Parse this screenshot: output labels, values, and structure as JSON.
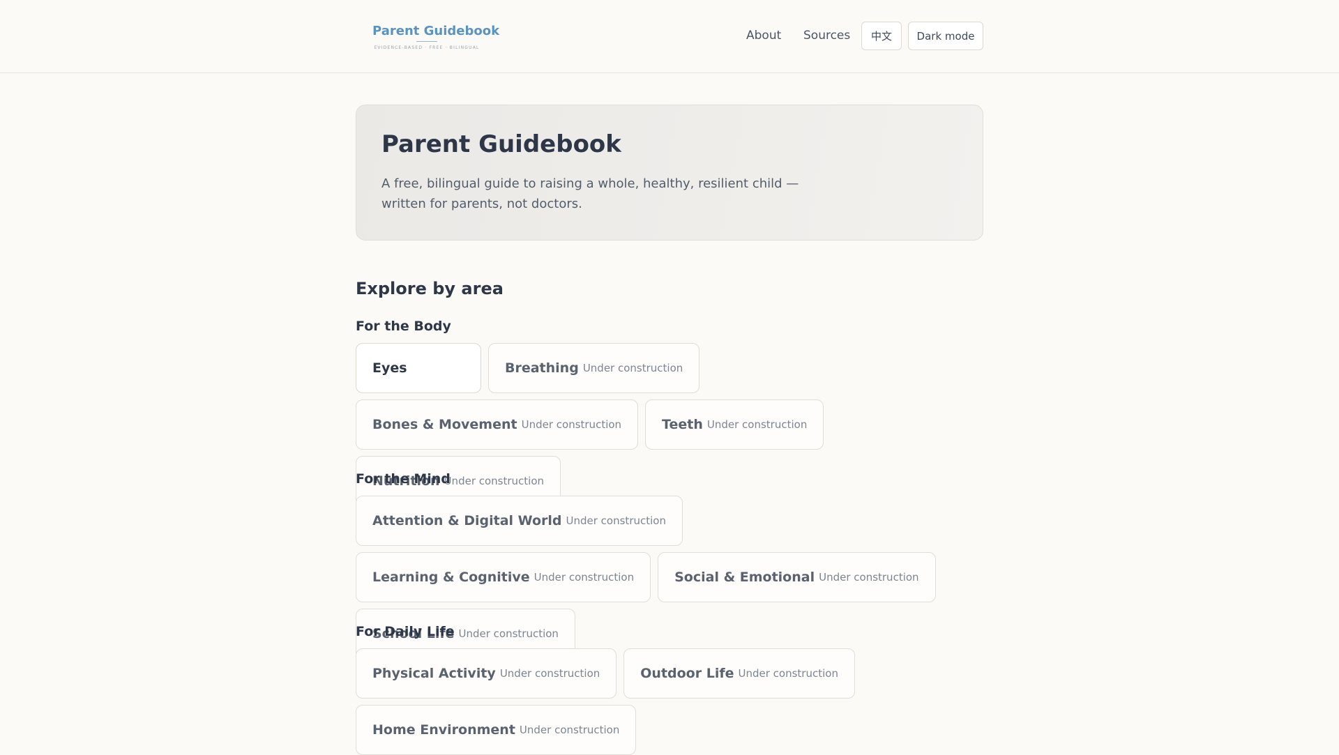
{
  "header": {
    "logo_title": "Parent Guidebook",
    "logo_tagline": "EVIDENCE-BASED · FREE · BILINGUAL",
    "nav": [
      {
        "label": "About"
      },
      {
        "label": "Sources"
      }
    ],
    "lang_button": "中文",
    "dark_mode_button": "Dark mode"
  },
  "hero": {
    "title": "Parent Guidebook",
    "subtitle": "A free, bilingual guide to raising a whole, healthy, resilient child — written for parents, not doctors."
  },
  "explore": {
    "title": "Explore by area",
    "groups": [
      {
        "title": "For the Body",
        "cards": [
          {
            "name": "Eyes",
            "status": ""
          },
          {
            "name": "Breathing",
            "status": "Under construction"
          },
          {
            "name": "Bones & Movement",
            "status": "Under construction"
          },
          {
            "name": "Teeth",
            "status": "Under construction"
          },
          {
            "name": "Nutrition",
            "status": "Under construction"
          }
        ]
      },
      {
        "title": "For the Mind",
        "cards": [
          {
            "name": "Attention & Digital World",
            "status": "Under construction"
          },
          {
            "name": "Learning & Cognitive",
            "status": "Under construction"
          },
          {
            "name": "Social & Emotional",
            "status": "Under construction"
          },
          {
            "name": "School Life",
            "status": "Under construction"
          }
        ]
      },
      {
        "title": "For Daily Life",
        "cards": [
          {
            "name": "Physical Activity",
            "status": "Under construction"
          },
          {
            "name": "Outdoor Life",
            "status": "Under construction"
          },
          {
            "name": "Home Environment",
            "status": "Under construction"
          }
        ]
      }
    ]
  }
}
